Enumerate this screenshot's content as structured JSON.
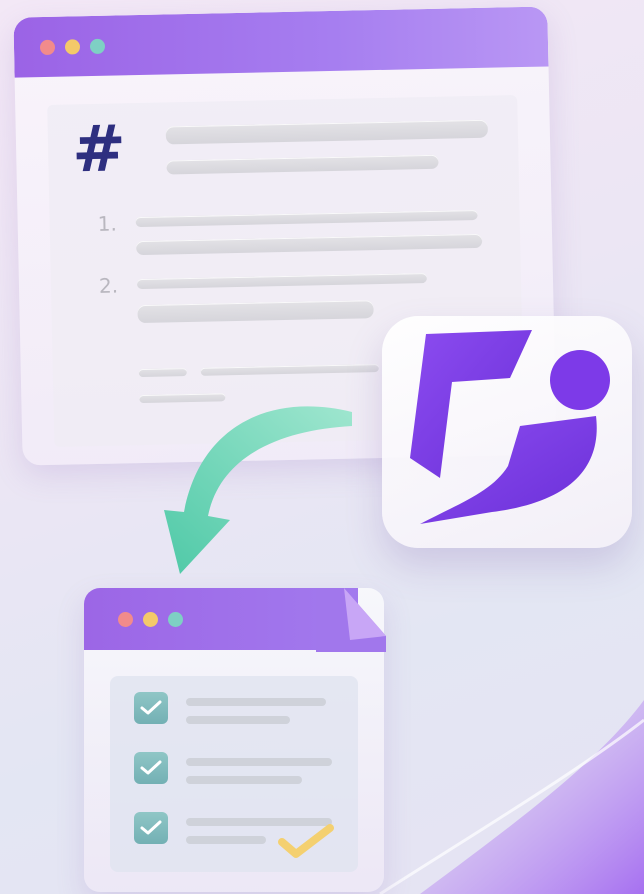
{
  "top_window": {
    "heading_symbol": "#",
    "list_numbers": [
      "1.",
      "2."
    ]
  },
  "icons": {
    "logo": "app-logo-icon",
    "arrow": "curved-arrow-icon",
    "check": "check-icon"
  },
  "colors": {
    "title_bar": "#9b63e6",
    "logo_purple": "#7a3ae6",
    "arrow_green": "#5fd0b0",
    "check_yellow": "#f4d070",
    "checkbox_teal": "#7ab8b8"
  }
}
